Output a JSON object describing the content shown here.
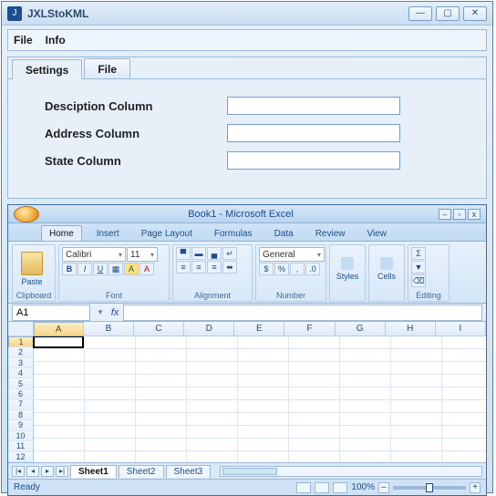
{
  "appwin": {
    "icon_text": "J",
    "title": "JXLStoKML",
    "min": "—",
    "max": "▢",
    "close": "✕"
  },
  "menubar": {
    "file": "File",
    "info": "Info"
  },
  "tabs": {
    "settings": "Settings",
    "file": "File"
  },
  "form": {
    "desc_label": "Desciption Column",
    "addr_label": "Address Column",
    "state_label": "State Column",
    "desc_value": "",
    "addr_value": "",
    "state_value": ""
  },
  "excel": {
    "title": "Book1 - Microsoft Excel",
    "win_min": "–",
    "win_max": "▫",
    "win_close": "x",
    "ribbon_tabs": {
      "home": "Home",
      "insert": "Insert",
      "pagelayout": "Page Layout",
      "formulas": "Formulas",
      "data": "Data",
      "review": "Review",
      "view": "View"
    },
    "groups": {
      "clipboard": "Clipboard",
      "font": "Font",
      "alignment": "Alignment",
      "number": "Number",
      "styles": "Styles",
      "cells": "Cells",
      "editing": "Editing"
    },
    "paste_label": "Paste",
    "font_name": "Calibri",
    "font_size": "11",
    "number_format": "General",
    "styles_label": "Styles",
    "cells_label": "Cells",
    "namebox": "A1",
    "fx": "fx",
    "columns": [
      "A",
      "B",
      "C",
      "D",
      "E",
      "F",
      "G",
      "H",
      "I"
    ],
    "rows": [
      "1",
      "2",
      "3",
      "4",
      "5",
      "6",
      "7",
      "8",
      "9",
      "10",
      "11",
      "12"
    ],
    "sheets": {
      "s1": "Sheet1",
      "s2": "Sheet2",
      "s3": "Sheet3"
    },
    "nav": {
      "first": "|◂",
      "prev": "◂",
      "next": "▸",
      "last": "▸|"
    },
    "status": {
      "ready": "Ready",
      "zoom": "100%",
      "minus": "–",
      "plus": "+"
    }
  }
}
